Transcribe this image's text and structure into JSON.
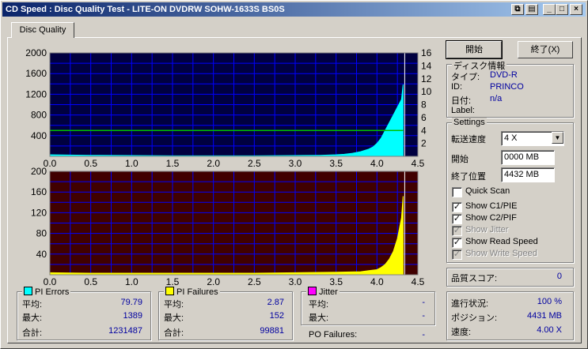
{
  "window": {
    "title": "CD Speed : Disc Quality Test - LITE-ON DVDRW SOHW-1633S BS0S"
  },
  "tabs": [
    {
      "label": "Disc Quality"
    }
  ],
  "buttons": {
    "start": "開始",
    "stop": "終了(X)"
  },
  "disc_info": {
    "title": "ディスク情報",
    "type_label": "タイプ:",
    "type_value": "DVD-R",
    "id_label": "ID:",
    "id_value": "PRINCO",
    "date_label": "日付:",
    "date_value": "n/a",
    "label_label": "Label:",
    "label_value": ""
  },
  "settings": {
    "title": "Settings",
    "speed_label": "転送速度",
    "speed_value": "4 X",
    "start_label": "開始",
    "start_value": "0000 MB",
    "end_label": "終了位置",
    "end_value": "4432 MB",
    "quick_scan": "Quick Scan",
    "show_c1": "Show C1/PIE",
    "show_c2": "Show C2/PIF",
    "show_jitter": "Show Jitter",
    "show_read": "Show Read Speed",
    "show_write": "Show Write Speed"
  },
  "quality": {
    "label": "品質スコア:",
    "value": "0"
  },
  "progress": {
    "progress_label": "進行状況:",
    "progress_value": "100 %",
    "position_label": "ポジション:",
    "position_value": "4431 MB",
    "speed_label": "速度:",
    "speed_value": "4.00 X"
  },
  "pi_errors": {
    "title": "PI Errors",
    "avg_label": "平均:",
    "avg": "79.79",
    "max_label": "最大:",
    "max": "1389",
    "total_label": "合計:",
    "total": "1231487"
  },
  "pi_failures": {
    "title": "PI Failures",
    "avg_label": "平均:",
    "avg": "2.87",
    "max_label": "最大:",
    "max": "152",
    "total_label": "合計:",
    "total": "99881"
  },
  "jitter": {
    "title": "Jitter",
    "avg_label": "平均:",
    "avg": "-",
    "max_label": "最大:",
    "max": "-"
  },
  "po_failures": {
    "label": "PO Failures:",
    "value": "-"
  },
  "colors": {
    "pie": "#00ffff",
    "pif": "#ffff00",
    "jitter": "#ff00ff",
    "speed": "#00c000",
    "top_bg": "#000040",
    "bottom_bg": "#400000",
    "grid": "#0000ff"
  },
  "chart_data": [
    {
      "type": "area",
      "series": [
        {
          "name": "PI Errors",
          "x": [
            0.0,
            0.5,
            1.0,
            1.5,
            2.0,
            2.5,
            3.0,
            3.3,
            3.5,
            3.6,
            3.7,
            3.8,
            3.9,
            3.95,
            4.0,
            4.05,
            4.1,
            4.15,
            4.2,
            4.25,
            4.3,
            4.32
          ],
          "values": [
            30,
            20,
            15,
            10,
            10,
            10,
            15,
            20,
            30,
            40,
            60,
            90,
            140,
            180,
            250,
            350,
            500,
            650,
            800,
            950,
            1100,
            1389
          ]
        }
      ],
      "read_speed": {
        "x": [
          0.0,
          4.32
        ],
        "values": [
          4.0,
          4.0
        ]
      },
      "xlim": [
        0,
        4.5
      ],
      "ylim": [
        0,
        2000
      ],
      "y2lim": [
        0,
        16
      ],
      "xticks": [
        "0.0",
        "0.5",
        "1.0",
        "1.5",
        "2.0",
        "2.5",
        "3.0",
        "3.5",
        "4.0",
        "4.5"
      ],
      "yticks": [
        "400",
        "800",
        "1200",
        "1600",
        "2000"
      ],
      "y2ticks": [
        "2",
        "4",
        "6",
        "8",
        "10",
        "12",
        "14",
        "16"
      ]
    },
    {
      "type": "area",
      "series": [
        {
          "name": "PI Failures",
          "x": [
            0.0,
            0.5,
            1.0,
            1.5,
            2.0,
            2.5,
            3.0,
            3.5,
            3.8,
            3.9,
            4.0,
            4.05,
            4.1,
            4.15,
            4.2,
            4.25,
            4.3,
            4.32
          ],
          "values": [
            4,
            3,
            3,
            3,
            3,
            3,
            4,
            5,
            6,
            8,
            10,
            14,
            20,
            30,
            45,
            70,
            110,
            152
          ]
        }
      ],
      "xlim": [
        0,
        4.5
      ],
      "ylim": [
        0,
        200
      ],
      "xticks": [
        "0.0",
        "0.5",
        "1.0",
        "1.5",
        "2.0",
        "2.5",
        "3.0",
        "3.5",
        "4.0",
        "4.5"
      ],
      "yticks": [
        "40",
        "80",
        "120",
        "160",
        "200"
      ]
    }
  ]
}
